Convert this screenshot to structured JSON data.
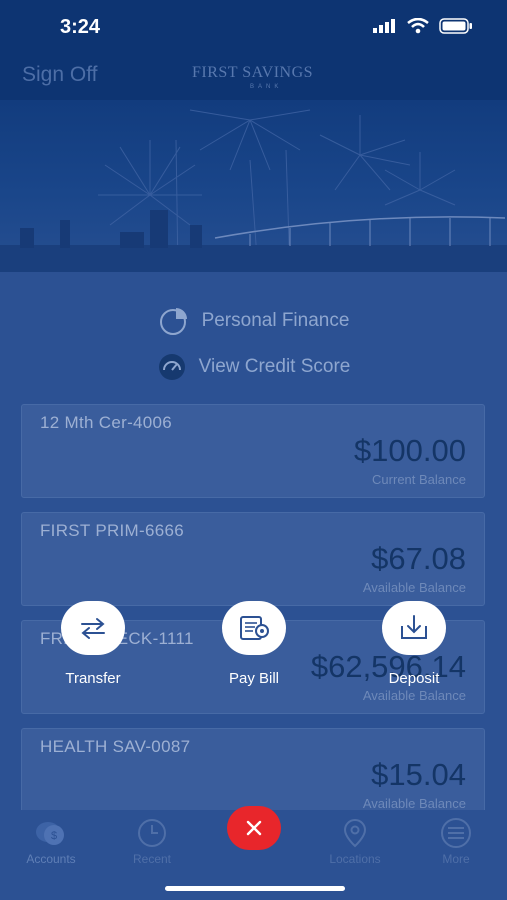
{
  "status": {
    "time": "3:24"
  },
  "nav": {
    "signoff": "Sign Off",
    "brand_main": "FIRST SAVINGS",
    "brand_sub": "BANK"
  },
  "links": [
    {
      "label": "Personal Finance",
      "icon": "pie-chart-icon"
    },
    {
      "label": "View Credit Score",
      "icon": "gauge-icon"
    }
  ],
  "accounts": [
    {
      "name": "12 Mth Cer-4006",
      "amount": "$100.00",
      "balance_label": "Current Balance"
    },
    {
      "name": "FIRST PRIM-6666",
      "amount": "$67.08",
      "balance_label": "Available Balance"
    },
    {
      "name": "FREE CHECK-1111",
      "amount": "$62,596.14",
      "balance_label": "Available Balance"
    },
    {
      "name": "HEALTH SAV-0087",
      "amount": "$15.04",
      "balance_label": "Available Balance"
    }
  ],
  "actions": [
    {
      "label": "Transfer",
      "icon": "transfer-arrows-icon"
    },
    {
      "label": "Pay Bill",
      "icon": "bill-icon"
    },
    {
      "label": "Deposit",
      "icon": "deposit-icon"
    }
  ],
  "tabs": [
    {
      "label": "Accounts",
      "icon": "accounts-icon"
    },
    {
      "label": "Recent",
      "icon": "clock-icon"
    },
    {
      "label": "Locations",
      "icon": "location-pin-icon"
    },
    {
      "label": "More",
      "icon": "menu-icon"
    }
  ],
  "colors": {
    "primary": "#0d3472",
    "background": "#2c5193",
    "close_button": "#e8262b"
  }
}
